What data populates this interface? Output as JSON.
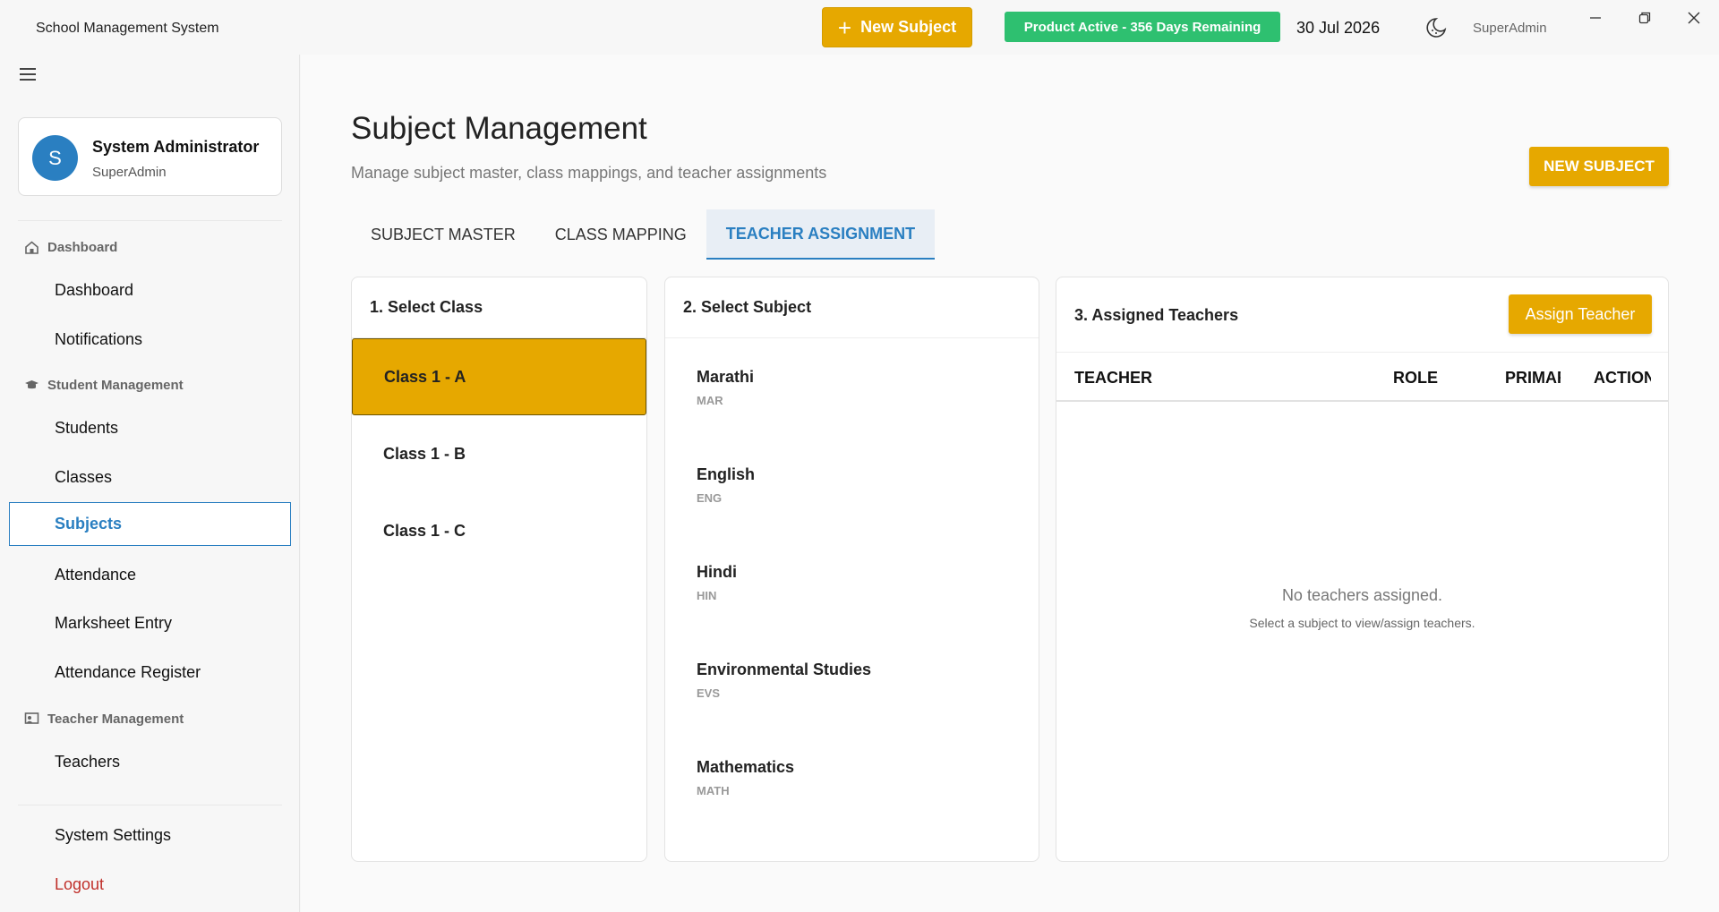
{
  "titlebar": {
    "app_title": "School Management System",
    "new_subject_label": "New Subject",
    "status_badge": "Product Active - 356 Days Remaining",
    "date": "30 Jul 2026",
    "user": "SuperAdmin"
  },
  "sidebar": {
    "profile": {
      "initial": "S",
      "name": "System Administrator",
      "role": "SuperAdmin"
    },
    "sections": {
      "dashboard": "Dashboard",
      "student_management": "Student Management",
      "teacher_management": "Teacher Management"
    },
    "items": {
      "dashboard": "Dashboard",
      "notifications": "Notifications",
      "students": "Students",
      "classes": "Classes",
      "subjects": "Subjects",
      "attendance": "Attendance",
      "marksheet_entry": "Marksheet Entry",
      "attendance_register": "Attendance Register",
      "teachers": "Teachers",
      "system_settings": "System Settings",
      "logout": "Logout"
    }
  },
  "main": {
    "title": "Subject Management",
    "subtitle": "Manage subject master, class mappings, and teacher assignments",
    "new_subject_button": "NEW SUBJECT",
    "tabs": [
      {
        "label": "SUBJECT MASTER"
      },
      {
        "label": "CLASS MAPPING"
      },
      {
        "label": "TEACHER ASSIGNMENT"
      }
    ],
    "select_class": {
      "title": "1. Select Class",
      "classes": [
        "Class 1 - A",
        "Class 1 - B",
        "Class 1 - C"
      ]
    },
    "select_subject": {
      "title": "2. Select Subject",
      "subjects": [
        {
          "name": "Marathi",
          "code": "MAR"
        },
        {
          "name": "English",
          "code": "ENG"
        },
        {
          "name": "Hindi",
          "code": "HIN"
        },
        {
          "name": "Environmental Studies",
          "code": "EVS"
        },
        {
          "name": "Mathematics",
          "code": "MATH"
        }
      ]
    },
    "assigned_teachers": {
      "title": "3. Assigned Teachers",
      "assign_button": "Assign Teacher",
      "columns": [
        "TEACHER",
        "ROLE",
        "PRIMARY",
        "ACTION"
      ],
      "empty_title": "No teachers assigned.",
      "empty_subtitle": "Select a subject to view/assign teachers."
    }
  },
  "colors": {
    "accent": "#e6a800",
    "link": "#2a7fc1",
    "success": "#2ec070",
    "danger": "#c0302a"
  }
}
